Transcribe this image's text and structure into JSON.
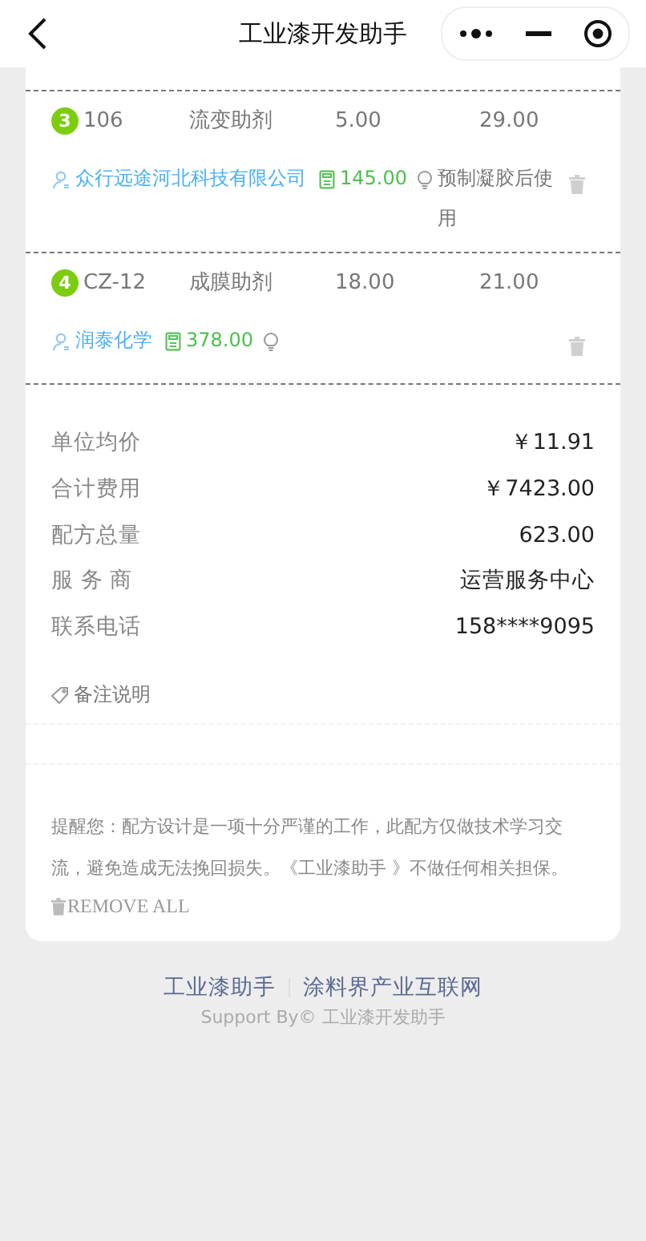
{
  "header": {
    "title": "工业漆开发助手"
  },
  "items": [
    {
      "number": "3",
      "code": "106",
      "name": "流变助剂",
      "column_4": "5.00",
      "column_5": "29.00",
      "supplier": "众行远途河北科技有限公司",
      "amount": "145.00",
      "note": "预制凝胶后使用"
    },
    {
      "number": "4",
      "code": "CZ-12",
      "name": "成膜助剂",
      "column_4": "18.00",
      "column_5": "21.00",
      "supplier": "润泰化学",
      "amount": "378.00"
    }
  ],
  "summary": [
    {
      "label": "单位均价",
      "value": "￥11.91"
    },
    {
      "label": "合计费用",
      "value": "￥7423.00"
    },
    {
      "label": "配方总量",
      "value": "623.00"
    },
    {
      "label": "服 务 商",
      "value": "运营服务中心"
    },
    {
      "label": "联系电话",
      "value": "158****9095"
    }
  ],
  "remark_label": "备注说明",
  "reminder": "提醒您：配方设计是一项十分严谨的工作，此配方仅做技术学习交流，避免造成无法挽回损失。《工业漆助手 》不做任何相关担保。",
  "remove_all": "REMOVE ALL",
  "footer": {
    "links": [
      "工业漆助手",
      "涂料界产业互联网"
    ],
    "support": "Support By© 工业漆开发助手"
  }
}
